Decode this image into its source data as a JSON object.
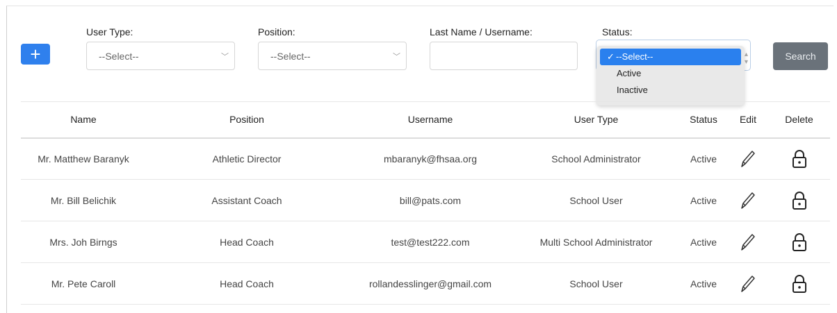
{
  "filters": {
    "add_label": "+",
    "user_type": {
      "label": "User Type:",
      "value": "--Select--"
    },
    "position": {
      "label": "Position:",
      "value": "--Select--"
    },
    "name": {
      "label": "Last Name / Username:",
      "value": ""
    },
    "status": {
      "label": "Status:",
      "value": "--Select--",
      "options": [
        {
          "check": "✓",
          "label": "--Select--"
        },
        {
          "check": "",
          "label": "Active"
        },
        {
          "check": "",
          "label": "Inactive"
        }
      ]
    },
    "search_label": "Search"
  },
  "table": {
    "headers": [
      "Name",
      "Position",
      "Username",
      "User Type",
      "Status",
      "Edit",
      "Delete"
    ],
    "rows": [
      {
        "name": "Mr. Matthew Baranyk",
        "position": "Athletic Director",
        "username": "mbaranyk@fhsaa.org",
        "user_type": "School Administrator",
        "status": "Active"
      },
      {
        "name": "Mr. Bill Belichik",
        "position": "Assistant Coach",
        "username": "bill@pats.com",
        "user_type": "School User",
        "status": "Active"
      },
      {
        "name": "Mrs. Joh Birngs",
        "position": "Head Coach",
        "username": "test@test222.com",
        "user_type": "Multi School Administrator",
        "status": "Active"
      },
      {
        "name": "Mr. Pete Caroll",
        "position": "Head Coach",
        "username": "rollandesslinger@gmail.com",
        "user_type": "School User",
        "status": "Active"
      }
    ]
  },
  "icons": {
    "edit": "pencil-icon",
    "delete": "lock-icon",
    "dropdown": "chevron-down-icon"
  },
  "colors": {
    "primary": "#2f80ed",
    "search_button": "#6a727a",
    "selected_option": "#2a80ee"
  }
}
